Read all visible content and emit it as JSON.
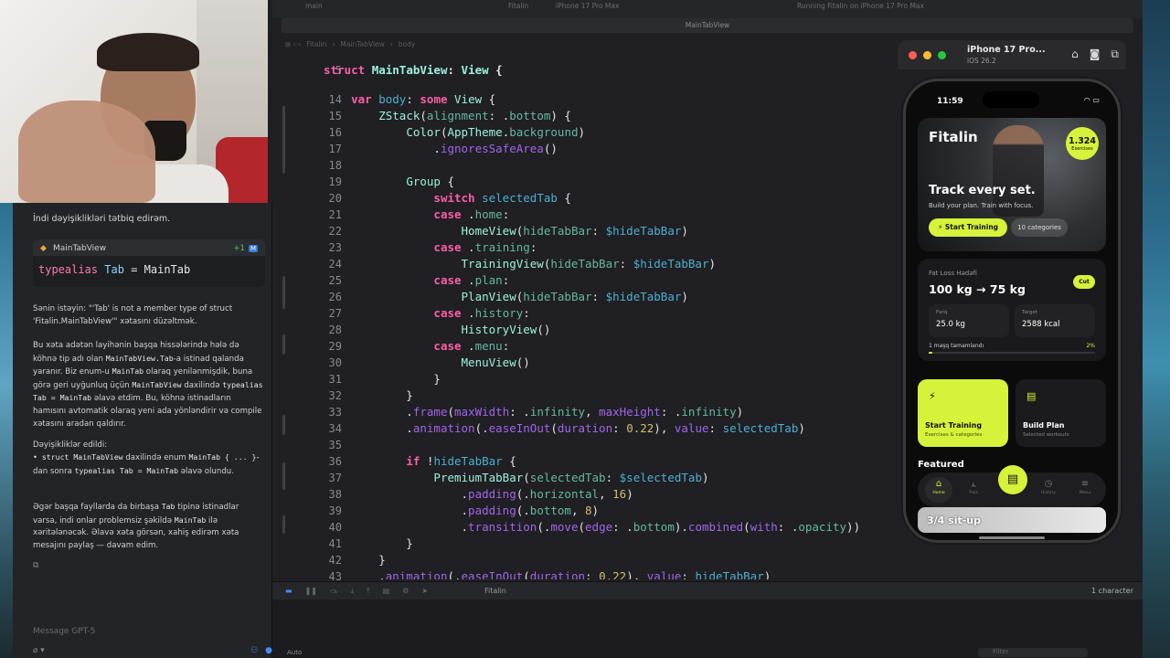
{
  "editor": {
    "top_bar": {
      "branch": "main",
      "scheme": "Fitalin",
      "destination": "iPhone 17 Pro Max",
      "status": "Running Fitalin on iPhone 17 Pro Max"
    },
    "tab_title": "MainTabView",
    "breadcrumbs": [
      "Fitalin",
      "MainTabView",
      "body"
    ],
    "lines": [
      {
        "n": "5"
      },
      {
        "n": "14"
      },
      {
        "n": "15"
      },
      {
        "n": "16"
      },
      {
        "n": "17"
      },
      {
        "n": "18"
      },
      {
        "n": "19"
      },
      {
        "n": "20"
      },
      {
        "n": "21"
      },
      {
        "n": "22"
      },
      {
        "n": "23"
      },
      {
        "n": "24"
      },
      {
        "n": "25"
      },
      {
        "n": "26"
      },
      {
        "n": "27"
      },
      {
        "n": "28"
      },
      {
        "n": "29"
      },
      {
        "n": "30"
      },
      {
        "n": "31"
      },
      {
        "n": "32"
      },
      {
        "n": "33"
      },
      {
        "n": "34"
      },
      {
        "n": "35"
      },
      {
        "n": "36"
      },
      {
        "n": "37"
      },
      {
        "n": "38"
      },
      {
        "n": "39"
      },
      {
        "n": "40"
      },
      {
        "n": "41"
      },
      {
        "n": "42"
      },
      {
        "n": "43"
      }
    ],
    "debug_bar": {
      "target": "Fitalin",
      "selection": "1 character"
    },
    "console": {
      "mode": "Auto",
      "filter_placeholder": "Filter"
    }
  },
  "chat": {
    "intro": "İndi dəyişiklikləri tətbiq edirəm.",
    "file_card": {
      "name": "MainTabView",
      "diff": "+1",
      "badge": "M",
      "code_kw": "typealias",
      "code_name": "Tab",
      "code_eq": "=",
      "code_type": "MainTab"
    },
    "p1": "Sənin istəyin: \"'Tab' is not a member type of struct 'Fitalin.MainTabView'\" xətasını düzəltmək.",
    "p2a": "Bu xəta adətən layihənin başqa hissələrində hələ də köhnə tip adı olan ",
    "p2b": "MainTabView.Tab",
    "p2c": "-a istinad qalanda yaranır. Biz enum-u ",
    "p2d": "MainTab",
    "p2e": " olaraq yenilənmişdik, buna görə geri uyğunluq üçün ",
    "p2f": "MainTabView",
    "p2g": " daxilində ",
    "p2h": "typealias Tab = MainTab",
    "p2i": " əlavə etdim. Bu, köhnə istinadların hamısını avtomatik olaraq yeni ada yönləndirir və compile xətasını aradan qaldırır.",
    "changes_title": "Dəyişikliklər edildi:",
    "c1a": "• struct MainTabView",
    "c1b": " daxilində enum ",
    "c1c": "MainTab { ... }",
    "c1d": "-dan sonra ",
    "c1e": "typealias Tab = MainTab",
    "c1f": " əlavə olundu.",
    "p3a": "Əgər başqa fayllarda da birbaşa ",
    "p3b": "Tab",
    "p3c": " tipinə istinadlar varsa, indi onlar problemsiz şəkildə ",
    "p3d": "MainTab",
    "p3e": " ilə xəritələnəcək. Əlavə xəta görsən, xahiş edirəm xəta mesajını paylaş — davam edim.",
    "input_placeholder": "Message GPT-5"
  },
  "simulator": {
    "device": "iPhone 17 Pro...",
    "os": "iOS 26.2",
    "app": {
      "time": "11:59",
      "brand": "Fitalin",
      "badge_number": "1.324",
      "badge_label": "Exercises",
      "headline": "Track every set.",
      "subline": "Build your plan. Train with focus.",
      "start_button": "Start Training",
      "categories_pill": "10 categories",
      "goal_label": "Fat Loss Hədəfi",
      "goal_value": "100 kg → 75 kg",
      "goal_pill": "Cut",
      "stat1_label": "Fərq",
      "stat1_value": "25.0 kg",
      "stat2_label": "Target",
      "stat2_value": "2588 kcal",
      "progress_label": "1 məşq tamamlandı",
      "progress_pct": "2%",
      "progress_value": 0.02,
      "card1_title": "Start Training",
      "card1_sub": "Exercises & categories",
      "card2_title": "Build Plan",
      "card2_sub": "Selected workouts",
      "featured": "Featured",
      "featured_item": "3/4 sit-up",
      "tabs": [
        {
          "label": "Home",
          "icon": "house-icon"
        },
        {
          "label": "Train",
          "icon": "dumbbell-icon"
        },
        {
          "label": "History",
          "icon": "clock-icon"
        },
        {
          "label": "Menu",
          "icon": "menu-icon"
        }
      ]
    }
  },
  "colors": {
    "accent": "#d7f23a",
    "keyword": "#fc5fa3",
    "type": "#9ef1dd",
    "function": "#a167e6",
    "number": "#d0bf69"
  }
}
